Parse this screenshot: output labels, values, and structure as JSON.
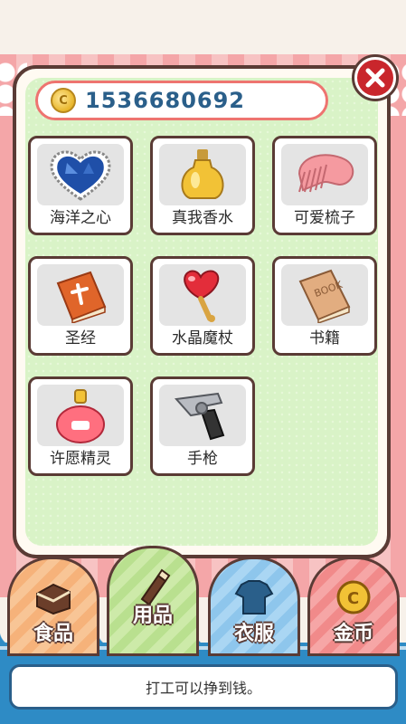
{
  "coins": {
    "value": "1536680692"
  },
  "items": [
    {
      "label": "海洋之心",
      "icon": "heart-gem-icon"
    },
    {
      "label": "真我香水",
      "icon": "perfume-icon"
    },
    {
      "label": "可爱梳子",
      "icon": "comb-icon"
    },
    {
      "label": "圣经",
      "icon": "bible-icon"
    },
    {
      "label": "水晶魔杖",
      "icon": "magic-wand-icon"
    },
    {
      "label": "书籍",
      "icon": "book-icon"
    },
    {
      "label": "许愿精灵",
      "icon": "wish-bottle-icon"
    },
    {
      "label": "手枪",
      "icon": "pistol-icon"
    }
  ],
  "book_cover_text": "BOOK",
  "tabs": [
    {
      "label": "食品",
      "icon": "cake-icon"
    },
    {
      "label": "用品",
      "icon": "lipstick-icon"
    },
    {
      "label": "衣服",
      "icon": "shirt-icon"
    },
    {
      "label": "金币",
      "icon": "coin-icon"
    }
  ],
  "message": "打工可以挣到钱。",
  "colors": {
    "accent_red": "#c9262c",
    "coin_blue": "#2a5f8a",
    "panel_green": "#d9f3c7",
    "border_brown": "#5a3b35"
  }
}
